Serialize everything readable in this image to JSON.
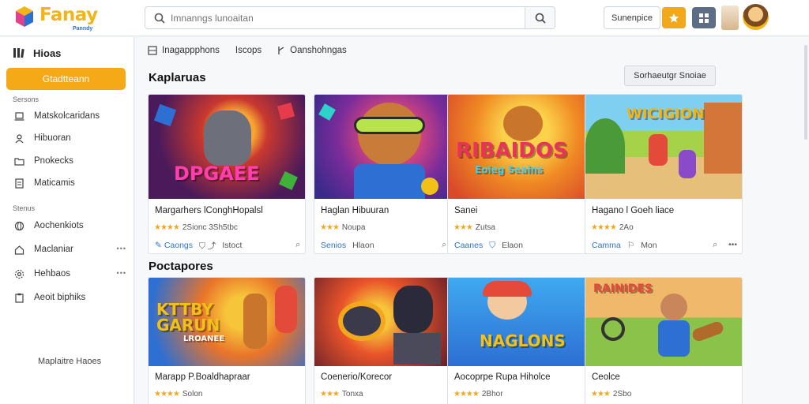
{
  "app": {
    "logo_text": "Fanay",
    "logo_sub": "Panndy"
  },
  "header": {
    "search_placeholder": "Imnanngs lunoaitan",
    "text_button": "Sunenpice"
  },
  "sidebar": {
    "top_label": "Hioas",
    "primary_button": "Gtadtteann",
    "section1": "Sersons",
    "items1": [
      {
        "label": "Matskolcaridans",
        "icon": "laptop-icon"
      },
      {
        "label": "Hibuoran",
        "icon": "user-icon"
      },
      {
        "label": "Pnokecks",
        "icon": "folder-icon"
      },
      {
        "label": "Maticamis",
        "icon": "document-icon"
      }
    ],
    "section2": "Stenus",
    "items2": [
      {
        "label": "Aochenkiots",
        "icon": "globe-icon",
        "more": ""
      },
      {
        "label": "Maclaniar",
        "icon": "home-icon",
        "more": "•••"
      },
      {
        "label": "Hehbaos",
        "icon": "gear-icon",
        "more": "•••"
      },
      {
        "label": "Aeoit biphiks",
        "icon": "clipboard-icon",
        "more": ""
      }
    ],
    "bottom_text": "Maplaitre Haoes"
  },
  "main": {
    "breadcrumb": [
      "Inagappphons",
      "Iscops",
      "Oanshohngas"
    ],
    "section1_title": "Kaplaruas",
    "sort_button": "Sorhaeutgr Snoiae",
    "section2_title": "Poctapores",
    "row1": [
      {
        "art": "DPGAEE",
        "title": "Margarhers lConghHopalsl",
        "stars": "★★★★",
        "rating": "2Sionc 3Sh5tbc",
        "foot_tag": "Caongs",
        "foot_label": "Istoct",
        "foot_right": [
          "",
          ""
        ]
      },
      {
        "art": "",
        "title": "Haglan Hibuuran",
        "stars": "★★★",
        "rating": "Noupa",
        "foot_tag": "Senios",
        "foot_label": "Hlaon",
        "foot_right": [
          "",
          "•••"
        ]
      },
      {
        "art": "RIBAIDOS",
        "art_sub": "Eoieg Seains",
        "title": "Sanei",
        "stars": "★★★",
        "rating": "Zutsa",
        "foot_tag": "Caanes",
        "foot_label": "Elaon",
        "foot_right": [
          "",
          ""
        ]
      },
      {
        "art": "WICIGION",
        "title": "Hagano l Goeh liace",
        "stars": "★★★★",
        "rating": "2Ao",
        "foot_tag": "Camma",
        "foot_label": "Mon",
        "foot_right": [
          "",
          "•••"
        ]
      }
    ],
    "row2": [
      {
        "art": "KTTBY GARUN",
        "art_sub": "LROANEE",
        "title": "Marapp P.Boaldhapraar",
        "stars": "★★★★",
        "rating": "Solon"
      },
      {
        "art": "",
        "title": "Coenerio/Korecor",
        "stars": "★★★",
        "rating": "Tonxa"
      },
      {
        "art": "NAGLONS",
        "title": "Aocoprpe Rupa Hiholce",
        "stars": "★★★★",
        "rating": "2Bhor"
      },
      {
        "art": "RAINIDES",
        "title": "Ceolce",
        "stars": "★★★",
        "rating": "2Sbo"
      }
    ]
  },
  "colors": {
    "accent": "#f5a917",
    "link": "#2d6fd3",
    "slate": "#5c6d85"
  }
}
